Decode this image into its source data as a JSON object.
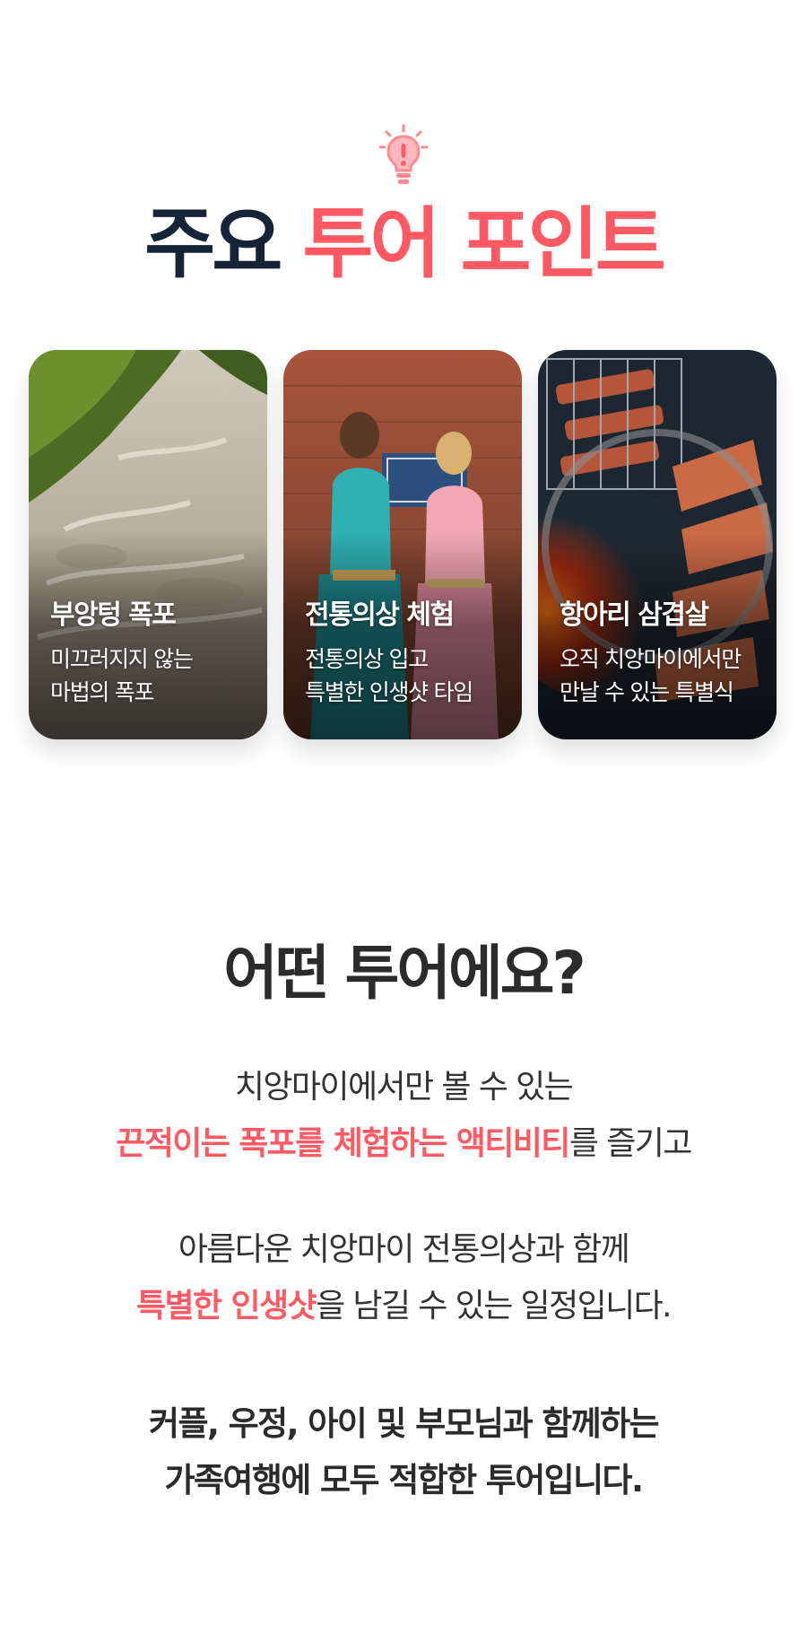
{
  "header": {
    "title_main": "주요",
    "title_accent": "투어 포인트",
    "icon": "lightbulb-icon",
    "accent_color": "#ff5a64",
    "title_color": "#172336"
  },
  "cards": [
    {
      "title": "부앙텅 폭포",
      "desc_line1": "미끄러지지 않는",
      "desc_line2": "마법의 폭포",
      "image": "waterfall-photo"
    },
    {
      "title": "전통의상 체험",
      "desc_line1": "전통의상 입고",
      "desc_line2": "특별한 인생샷 타임",
      "image": "traditional-costume-photo"
    },
    {
      "title": "항아리 삼겹살",
      "desc_line1": "오직 치앙마이에서만",
      "desc_line2": "만날 수 있는 특별식",
      "image": "jar-pork-belly-photo"
    }
  ],
  "about": {
    "title": "어떤 투어에요?",
    "line1": "치앙마이에서만 볼 수 있는",
    "line2_highlight": "끈적이는 폭포를 체험하는 액티비티",
    "line2_rest": "를 즐기고",
    "line3": "아름다운 치앙마이 전통의상과 함께",
    "line4_highlight": "특별한 인생샷",
    "line4_rest": "을 남길 수 있는 일정입니다.",
    "line5": "커플, 우정, 아이 및 부모님과 함께하는",
    "line6": "가족여행에 모두 적합한 투어입니다."
  }
}
